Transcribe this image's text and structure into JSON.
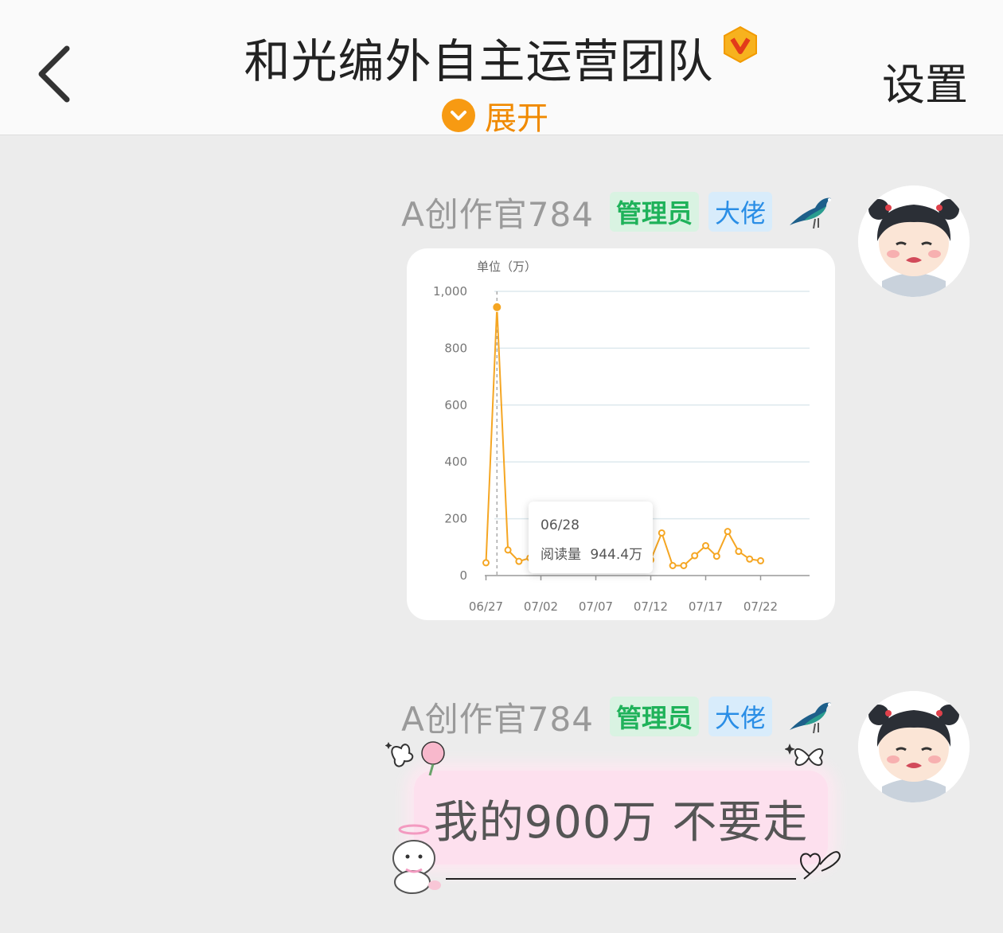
{
  "header": {
    "title": "和光编外自主运营团队",
    "expand_label": "展开",
    "settings_label": "设置"
  },
  "messages": [
    {
      "sender": "A创作官784",
      "tags": [
        "管理员",
        "大佬"
      ],
      "type": "chart"
    },
    {
      "sender": "A创作官784",
      "tags": [
        "管理员",
        "大佬"
      ],
      "type": "text",
      "text": "我的900万 不要走"
    }
  ],
  "colors": {
    "accent": "#f79a12",
    "line": "#f5a623",
    "admin_tag": "#1fb25a",
    "boss_tag": "#2a8ee6"
  },
  "tooltip": {
    "date": "06/28",
    "label": "阅读量",
    "value": "944.4万"
  },
  "chart_data": {
    "type": "line",
    "unit_label": "单位（万）",
    "ylim": [
      0,
      1000
    ],
    "y_ticks": [
      "0",
      "200",
      "400",
      "600",
      "800",
      "1,000"
    ],
    "x_tick_labels": [
      "06/27",
      "07/02",
      "07/07",
      "07/12",
      "07/17",
      "07/22"
    ],
    "grid": true,
    "series": [
      {
        "values": [
          45,
          944.4,
          90,
          50,
          62,
          70,
          72,
          68,
          75,
          80,
          85,
          90,
          105,
          55,
          145,
          55,
          150,
          35,
          35,
          70,
          105,
          68,
          155,
          85,
          58,
          52
        ]
      }
    ],
    "highlight_index": 1
  }
}
